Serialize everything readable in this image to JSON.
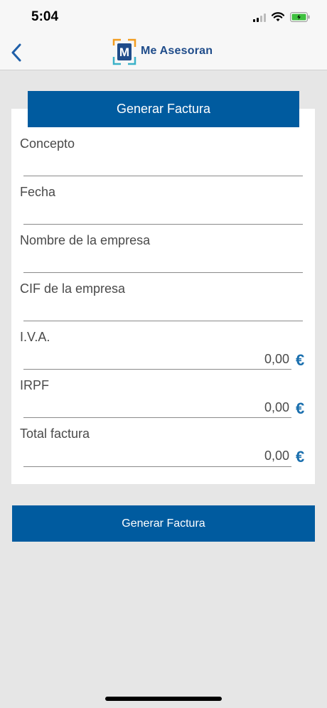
{
  "status": {
    "time": "5:04"
  },
  "nav": {
    "logo_letter": "M",
    "logo_text": "Me Asesoran"
  },
  "form": {
    "header": "Generar Factura",
    "fields": [
      {
        "label": "Concepto",
        "value": ""
      },
      {
        "label": "Fecha",
        "value": ""
      },
      {
        "label": "Nombre de la empresa",
        "value": ""
      },
      {
        "label": "CIF de la empresa",
        "value": ""
      },
      {
        "label": "I.V.A.",
        "value": "0,00",
        "unit": "€"
      },
      {
        "label": "IRPF",
        "value": "0,00",
        "unit": "€"
      },
      {
        "label": "Total factura",
        "value": "0,00",
        "unit": "€"
      }
    ]
  },
  "submit_label": "Generar Factura",
  "colors": {
    "primary": "#005b9f",
    "background": "#e6e6e6",
    "euro": "#1a6fae"
  }
}
